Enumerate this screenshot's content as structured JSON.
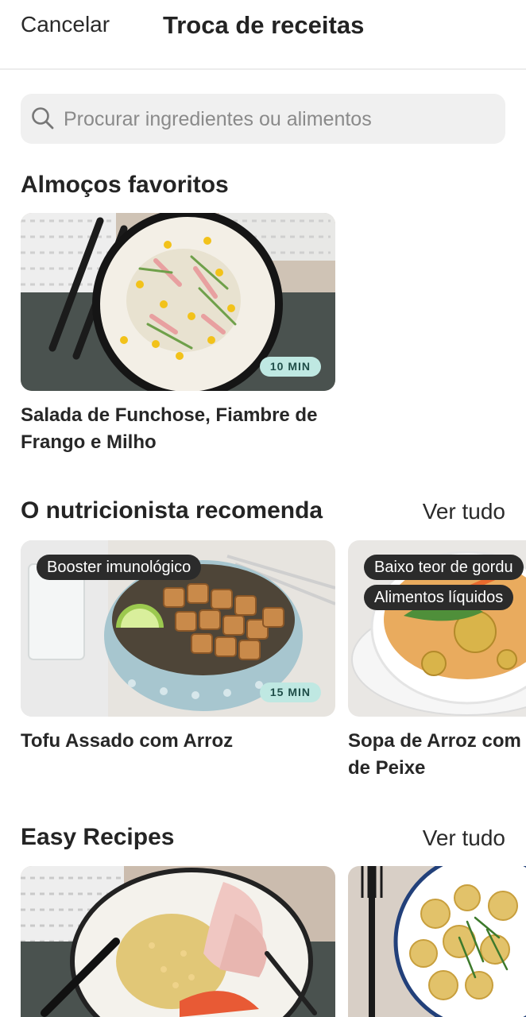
{
  "header": {
    "cancel_label": "Cancelar",
    "title": "Troca de receitas"
  },
  "search": {
    "placeholder": "Procurar ingredientes ou alimentos",
    "icon": "search-icon"
  },
  "favorites": {
    "title": "Almoços favoritos",
    "cards": [
      {
        "name": "Salada de Funchose, Fiambre de Frango e Milho",
        "time": "10 MIN"
      }
    ]
  },
  "nutritionist": {
    "title": "O nutricionista recomenda",
    "see_all": "Ver tudo",
    "cards": [
      {
        "name": "Tofu Assado com Arroz",
        "time": "15 MIN",
        "tags": [
          "Booster imunológico"
        ]
      },
      {
        "name": "Sopa de Arroz com Bolinhos de Peixe",
        "name_visible": "Sopa de Arroz com",
        "name_line2": "de Peixe",
        "tags": [
          "Baixo teor de gordu",
          "Alimentos líquidos"
        ]
      }
    ]
  },
  "easy": {
    "title": "Easy Recipes",
    "see_all": "Ver tudo"
  },
  "colors": {
    "badge_bg": "#bfe8e2",
    "tag_bg": "#2b2b2b",
    "search_bg": "#f0f0f0"
  }
}
